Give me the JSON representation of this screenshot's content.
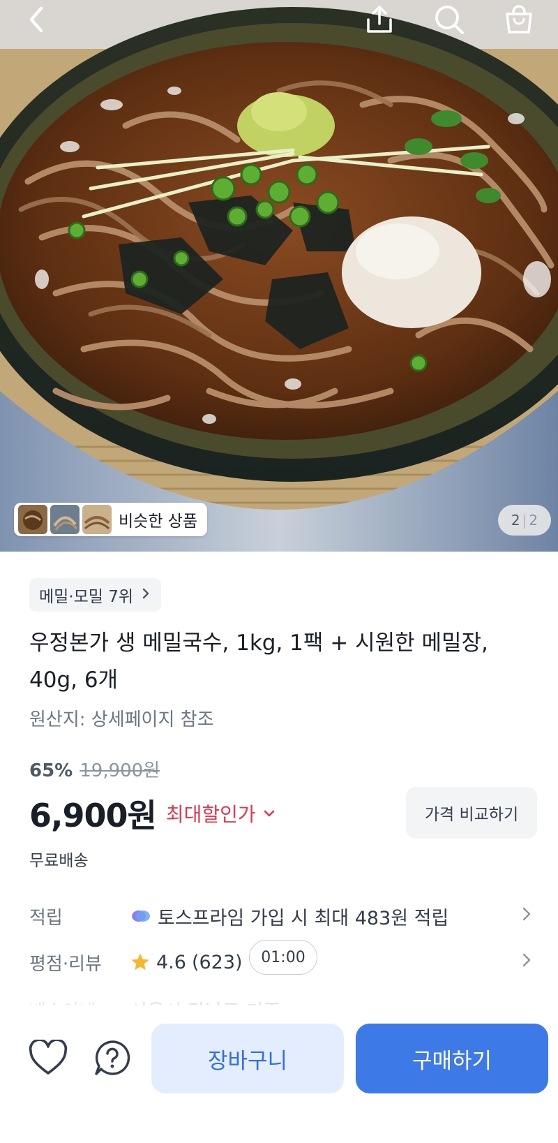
{
  "topbar": {
    "back_icon": "chevron-left-icon",
    "share_icon": "share-icon",
    "search_icon": "search-icon",
    "bag_icon": "shopping-bag-icon"
  },
  "hero": {
    "similar_label": "비슷한 상품",
    "page_current": "2",
    "page_separator": "|",
    "page_total": "2"
  },
  "product": {
    "rank_badge": "메밀·모밀 7위",
    "title_line1": "우정본가 생 메밀국수, 1kg, 1팩 + 시원한 메밀장,",
    "title_line2": "40g, 6개",
    "origin": "원산지: 상세페이지 참조",
    "discount_percent": "65%",
    "original_price": "19,900원",
    "price": "6,900원",
    "max_discount_label": "최대할인가",
    "compare_button": "가격 비교하기",
    "shipping": "무료배송"
  },
  "details": {
    "points_key": "적립",
    "points_value": "토스프라임 가입 시 최대 483원 적립",
    "review_key": "평점·리뷰",
    "rating": "4.6",
    "review_count": "(623)",
    "timer": "01:00",
    "faded_key": "배송안내",
    "faded_value": "서울시 강남구 기준"
  },
  "bottom": {
    "cart_button": "장바구니",
    "buy_button": "구매하기"
  },
  "colors": {
    "accent": "#3d7ae8",
    "cart_bg": "#e3edfd",
    "deal_red": "#e8344e",
    "star": "#f5b731"
  }
}
